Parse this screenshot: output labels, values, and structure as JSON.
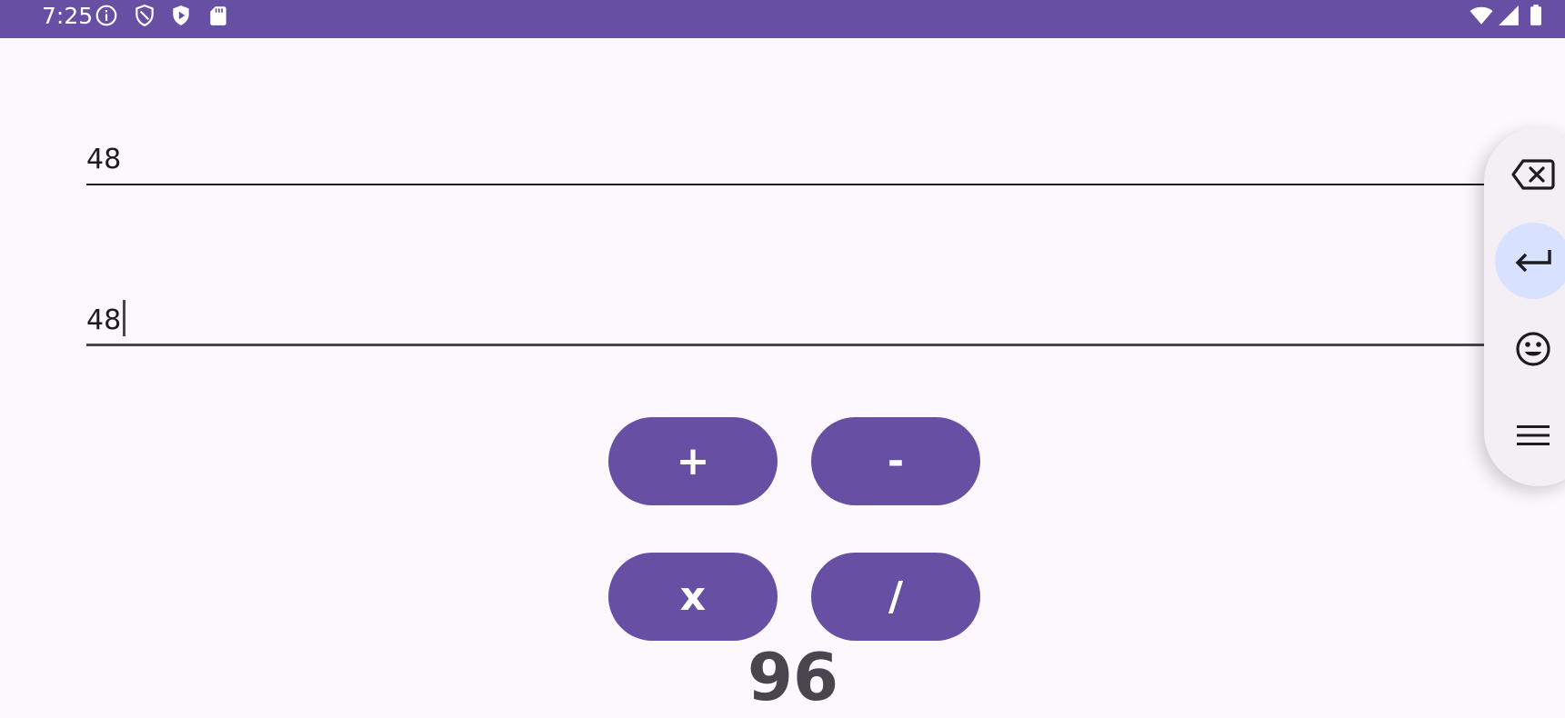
{
  "status_bar": {
    "time": "7:25",
    "left_icons": [
      "info-icon",
      "shield-icon",
      "play-protect-icon",
      "sd-card-icon"
    ],
    "right_icons": [
      "wifi-icon",
      "signal-icon",
      "battery-icon"
    ],
    "background": "#6750a4"
  },
  "inputs": {
    "first_number": "48",
    "second_number": "48"
  },
  "operations": {
    "add": "+",
    "subtract": "-",
    "multiply": "x",
    "divide": "/"
  },
  "result": "96",
  "floating_keyboard": {
    "keys": [
      "backspace-icon",
      "enter-icon",
      "emoji-icon",
      "menu-icon"
    ]
  },
  "colors": {
    "accent": "#6750a4",
    "background": "#fdf7fe",
    "highlight": "#d8e2ff"
  }
}
